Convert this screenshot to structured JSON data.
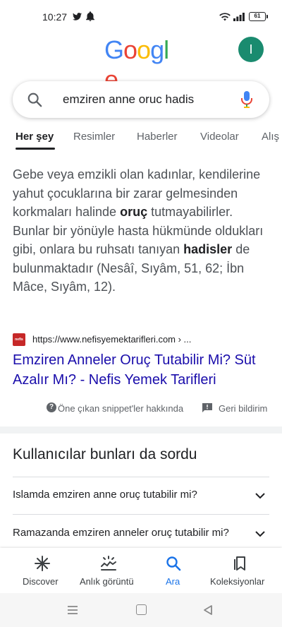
{
  "status_bar": {
    "time": "10:27",
    "battery": "61",
    "icons": [
      "twitter-icon",
      "bell-icon",
      "wifi-icon",
      "signal-icon",
      "battery-icon"
    ]
  },
  "header": {
    "logo_letters": [
      "G",
      "o",
      "o",
      "g",
      "l",
      "e"
    ],
    "logo_colors": [
      "#4285F4",
      "#EA4335",
      "#FBBC05",
      "#4285F4",
      "#34A853",
      "#EA4335"
    ],
    "avatar_initial": "I",
    "avatar_color": "#1a8b6f"
  },
  "search": {
    "query": "emziren anne oruc hadis"
  },
  "tabs": [
    {
      "label": "Her şey",
      "active": true
    },
    {
      "label": "Resimler",
      "active": false
    },
    {
      "label": "Haberler",
      "active": false
    },
    {
      "label": "Videolar",
      "active": false
    },
    {
      "label": "Alış",
      "active": false
    }
  ],
  "featured_snippet": {
    "text_parts": [
      {
        "t": "Gebe veya emzikli olan kadınlar, kendilerine yahut çocuklarına bir zarar gelmesinden korkmaları halinde ",
        "b": false
      },
      {
        "t": "oruç",
        "b": true
      },
      {
        "t": " tutmayabilirler. Bunlar bir yönüyle hasta hükmünde oldukları gibi, onlara bu ruhsatı tanıyan ",
        "b": false
      },
      {
        "t": "hadisler",
        "b": true
      },
      {
        "t": " de bulunmaktadır (Nesâî, Sıyâm, 51, 62; İbn Mâce, Sıyâm, 12).",
        "b": false
      }
    ],
    "favicon_text": "nefis",
    "source_url": "https://www.nefisyemektarifleri.com › ...",
    "result_title": "Emziren Anneler Oruç Tutabilir Mi? Süt Azalır Mı? - Nefis Yemek Tarifleri",
    "about_label": "Öne çıkan snippet'ler hakkında",
    "feedback_label": "Geri bildirim"
  },
  "people_also_ask": {
    "title": "Kullanıcılar bunları da sordu",
    "questions": [
      "Islamda emziren anne oruç tutabilir mi?",
      "Ramazanda emziren anneler oruç tutabilir mi?"
    ]
  },
  "bottom_nav": [
    {
      "label": "Discover",
      "icon": "asterisk-icon",
      "active": false
    },
    {
      "label": "Anlık görüntü",
      "icon": "snapshot-icon",
      "active": false
    },
    {
      "label": "Ara",
      "icon": "search-icon",
      "active": true
    },
    {
      "label": "Koleksiyonlar",
      "icon": "bookmarks-icon",
      "active": false
    }
  ],
  "colors": {
    "link": "#1a0dab",
    "accent": "#1a73e8",
    "text": "#202124",
    "muted": "#5f6368"
  }
}
